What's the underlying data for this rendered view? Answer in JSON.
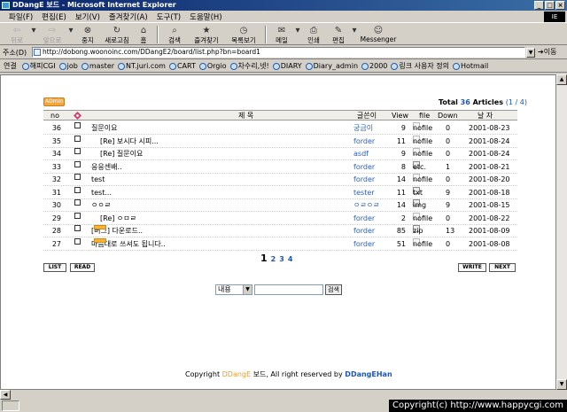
{
  "window": {
    "title": "DDangE 보드 - Microsoft Internet Explorer",
    "logo": "IE"
  },
  "menu": [
    "파일(F)",
    "편집(E)",
    "보기(V)",
    "즐겨찾기(A)",
    "도구(T)",
    "도움말(H)"
  ],
  "toolbar": {
    "back": "뒤로",
    "forward": "앞으로",
    "stop": "중지",
    "refresh": "새로고침",
    "home": "홈",
    "search": "검색",
    "favorites": "즐겨찾기",
    "history": "목록보기",
    "mail": "메일",
    "print": "인쇄",
    "edit": "편집",
    "messenger": "Messenger"
  },
  "address": {
    "label": "주소(D)",
    "url": "http://dobong.woonoinc.com/DDangE2/board/list.php?bn=board1",
    "go": "이동"
  },
  "links": {
    "label": "연결",
    "items": [
      "해피CGI",
      "job",
      "master",
      "NT.juri.com",
      "CART",
      "Orgio",
      "차수리,넷!",
      "DIARY",
      "Diary_admin",
      "2000",
      "링크 사용자 정의",
      "Hotmail"
    ]
  },
  "board": {
    "admin_badge": "ADmin",
    "total_prefix": "Total",
    "total_count": "36",
    "total_suffix": "Articles",
    "page_info": "(1 / 4)",
    "headers": {
      "no": "no",
      "title": "제 목",
      "writer": "글쓴이",
      "view": "View",
      "file": "file",
      "down": "Down",
      "date": "날 자"
    },
    "rows": [
      {
        "no": "36",
        "title": "질문이요",
        "writer": "궁금이",
        "view": "9",
        "file": "nofile",
        "down": "0",
        "date": "2001-08-23",
        "indent": false,
        "new": false
      },
      {
        "no": "35",
        "title": "[Re] 보시다 시피...",
        "writer": "forder",
        "view": "11",
        "file": "nofile",
        "down": "0",
        "date": "2001-08-24",
        "indent": true,
        "new": false
      },
      {
        "no": "34",
        "title": "[Re] 질문이요",
        "writer": "asdf",
        "view": "9",
        "file": "nofile",
        "down": "0",
        "date": "2001-08-24",
        "indent": true,
        "new": false
      },
      {
        "no": "33",
        "title": "응응센배..",
        "writer": "forder",
        "view": "8",
        "file": "etc.",
        "down": "1",
        "date": "2001-08-21",
        "indent": false,
        "new": false
      },
      {
        "no": "32",
        "title": "test",
        "writer": "forder",
        "view": "14",
        "file": "nofile",
        "down": "0",
        "date": "2001-08-20",
        "indent": false,
        "new": false
      },
      {
        "no": "31",
        "title": "test...",
        "writer": "tester",
        "view": "11",
        "file": "txt",
        "down": "9",
        "date": "2001-08-18",
        "indent": false,
        "new": false
      },
      {
        "no": "30",
        "title": "ㅇㅇㄹ",
        "writer": "ㅇㄹㅇㄹ",
        "view": "14",
        "file": "img",
        "down": "9",
        "date": "2001-08-15",
        "indent": false,
        "new": false
      },
      {
        "no": "29",
        "title": "[Re] ㅇㅁㄹ",
        "writer": "forder",
        "view": "2",
        "file": "nofile",
        "down": "0",
        "date": "2001-08-22",
        "indent": true,
        "new": false
      },
      {
        "no": "28",
        "title": "[버그] 다운로드..",
        "writer": "forder",
        "view": "85",
        "file": "zip",
        "down": "13",
        "date": "2001-08-09",
        "indent": false,
        "new": true
      },
      {
        "no": "27",
        "title": "마음대로 쓰셔도 됩니다..",
        "writer": "forder",
        "view": "51",
        "file": "nofile",
        "down": "0",
        "date": "2001-08-08",
        "indent": false,
        "new": true
      }
    ],
    "pages": {
      "current": "1",
      "others": [
        "2",
        "3",
        "4"
      ]
    },
    "buttons": {
      "list": "LIST",
      "read": "READ",
      "write": "WRITE",
      "next": "NEXT"
    },
    "search": {
      "field": "내용",
      "button": "검색"
    },
    "footer": {
      "prefix": "Copyright",
      "brand": "DDangE",
      "middle": "보드, All right reserved by",
      "author": "DDangEHan"
    }
  },
  "status": {
    "copyright": "Copyright(c) http://www.happycgi.com"
  }
}
